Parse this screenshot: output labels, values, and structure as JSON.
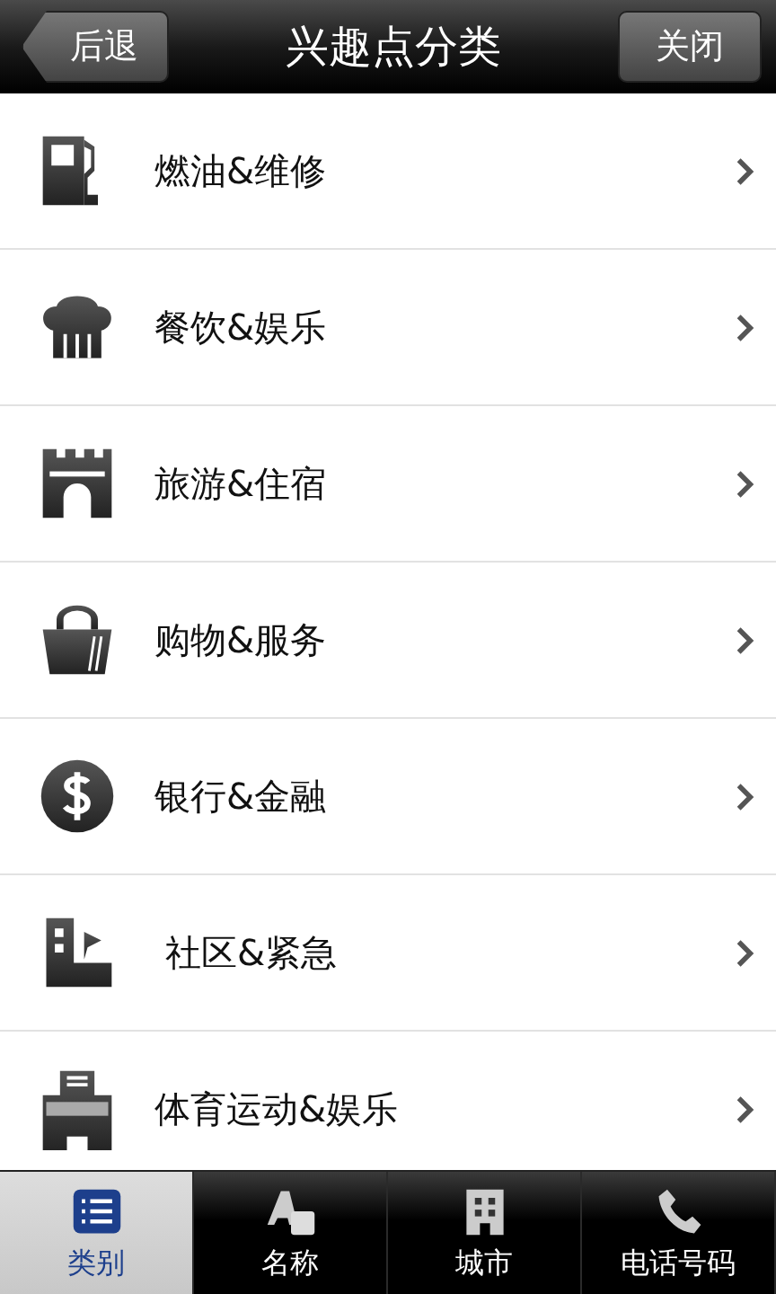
{
  "header": {
    "back": "后退",
    "title": "兴趣点分类",
    "close": "关闭"
  },
  "categories": [
    {
      "kind": "fuel",
      "label": "燃油&维修"
    },
    {
      "kind": "food",
      "label": "餐饮&娱乐"
    },
    {
      "kind": "castle",
      "label": "旅游&住宿"
    },
    {
      "kind": "shopping",
      "label": "购物&服务"
    },
    {
      "kind": "bank",
      "label": "银行&金融"
    },
    {
      "kind": "community",
      "label": "社区&紧急"
    },
    {
      "kind": "sport",
      "label": "体育运动&娱乐"
    }
  ],
  "tabs": [
    {
      "kind": "list",
      "label": "类别",
      "selected": true
    },
    {
      "kind": "ab",
      "label": "名称",
      "selected": false
    },
    {
      "kind": "building",
      "label": "城市",
      "selected": false
    },
    {
      "kind": "phone",
      "label": "电话号码",
      "selected": false
    }
  ]
}
